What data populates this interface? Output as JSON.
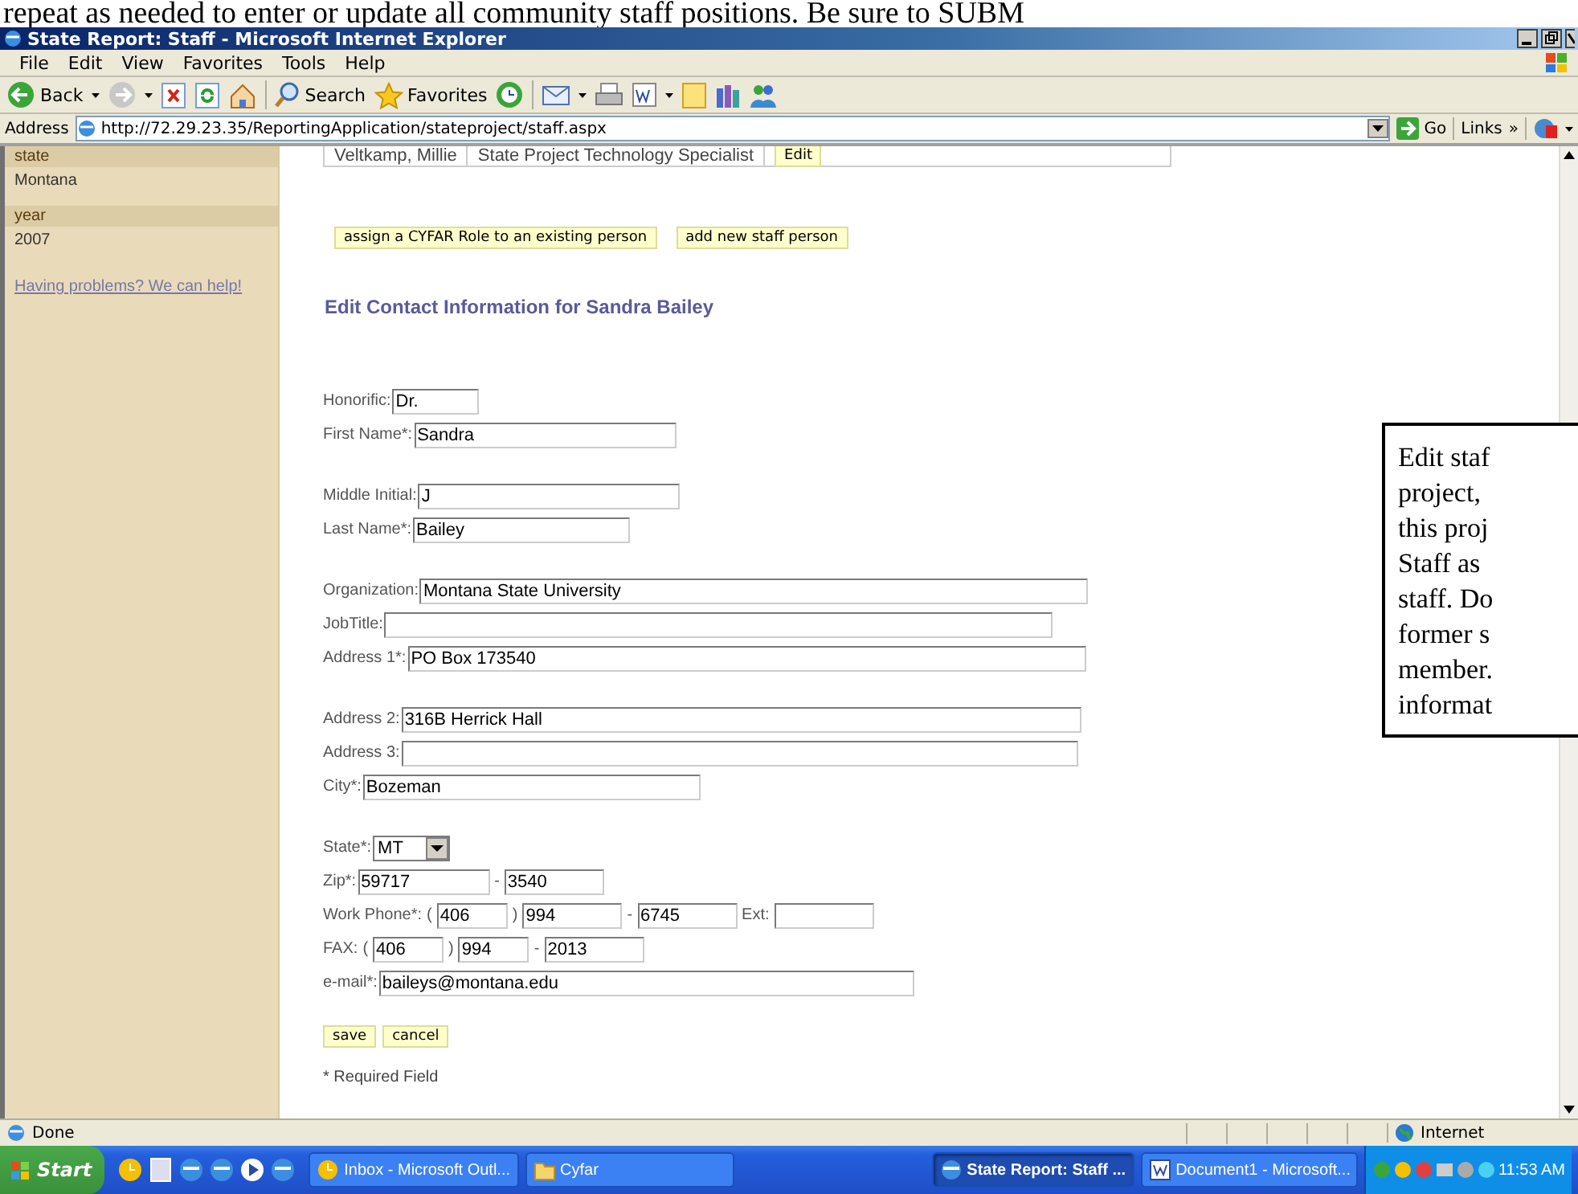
{
  "caption_line": "repeat as needed to enter or update all community staff positions. Be sure to SUBM",
  "window": {
    "title": "State Report: Staff - Microsoft Internet Explorer"
  },
  "menu": [
    "File",
    "Edit",
    "View",
    "Favorites",
    "Tools",
    "Help"
  ],
  "toolbar": {
    "back": "Back",
    "search": "Search",
    "favorites": "Favorites"
  },
  "address": {
    "label": "Address",
    "url": "http://72.29.23.35/ReportingApplication/stateproject/staff.aspx",
    "go": "Go",
    "links": "Links",
    "chevron": "»"
  },
  "sidebar": {
    "sections": [
      {
        "heading": "state",
        "value": "Montana"
      },
      {
        "heading": "year",
        "value": "2007"
      }
    ],
    "help_link": "Having problems? We can help!"
  },
  "staff_row": {
    "name": "Veltkamp, Millie",
    "role": "State Project Technology Specialist",
    "button": "Edit"
  },
  "actions": [
    "assign a CYFAR Role to an existing person",
    "add new staff person"
  ],
  "form": {
    "heading": "Edit Contact Information for Sandra Bailey",
    "groups": [
      [
        {
          "label": "Honorific:",
          "parts": [
            {
              "kind": "input",
              "value": "Dr."
            }
          ]
        },
        {
          "label": "First Name*:",
          "parts": [
            {
              "kind": "input",
              "value": "Sandra"
            }
          ]
        }
      ],
      [
        {
          "label": "Middle Initial:",
          "parts": [
            {
              "kind": "input",
              "value": "J"
            }
          ]
        },
        {
          "label": "Last Name*:",
          "parts": [
            {
              "kind": "input",
              "value": "Bailey"
            }
          ]
        }
      ],
      [
        {
          "label": "Organization:",
          "parts": [
            {
              "kind": "input",
              "value": "Montana State University"
            }
          ]
        },
        {
          "label": "JobTitle:",
          "parts": [
            {
              "kind": "input"
            }
          ]
        },
        {
          "label": "Address 1*:",
          "parts": [
            {
              "kind": "input",
              "value": "PO Box 173540"
            }
          ]
        }
      ],
      [
        {
          "label": "Address 2:",
          "parts": [
            {
              "kind": "input",
              "value": "316B Herrick Hall"
            }
          ]
        },
        {
          "label": "Address 3:",
          "parts": [
            {
              "kind": "input"
            }
          ]
        },
        {
          "label": "City*:",
          "parts": [
            {
              "kind": "input",
              "value": "Bozeman"
            }
          ]
        }
      ],
      [
        {
          "label": "State*:",
          "parts": [
            {
              "kind": "select",
              "value": "MT"
            }
          ]
        },
        {
          "label": "Zip*:",
          "parts": [
            {
              "kind": "input",
              "value": "59717"
            },
            {
              "kind": "sep",
              "text": "-"
            },
            {
              "kind": "input",
              "value": "3540"
            }
          ]
        },
        {
          "label": "Work Phone*:",
          "parts": [
            {
              "kind": "sep",
              "text": "("
            },
            {
              "kind": "input",
              "value": "406"
            },
            {
              "kind": "sep",
              "text": ")"
            },
            {
              "kind": "input",
              "value": "994"
            },
            {
              "kind": "sep",
              "text": "-"
            },
            {
              "kind": "input",
              "value": "6745"
            },
            {
              "kind": "sep",
              "text": "Ext:"
            },
            {
              "kind": "input"
            }
          ]
        },
        {
          "label": "FAX:",
          "parts": [
            {
              "kind": "sep",
              "text": "("
            },
            {
              "kind": "input",
              "value": "406"
            },
            {
              "kind": "sep",
              "text": ")"
            },
            {
              "kind": "input",
              "value": "994"
            },
            {
              "kind": "sep",
              "text": "-"
            },
            {
              "kind": "input",
              "value": "2013"
            }
          ]
        },
        {
          "label": "e-mail*:",
          "parts": [
            {
              "kind": "input",
              "value": "baileys@montana.edu"
            }
          ]
        }
      ]
    ],
    "buttons": [
      "save",
      "cancel"
    ],
    "note": "* Required Field"
  },
  "callout_lines": [
    "Edit staf",
    "project,",
    "this proj",
    "Staff as",
    "staff. Do",
    "former s",
    "member.",
    "informat"
  ],
  "status": {
    "text": "Done",
    "zone": "Internet"
  },
  "taskbar": {
    "start": "Start",
    "items": [
      {
        "label": "Inbox - Microsoft Outl...",
        "kind": "mail",
        "selected": false
      },
      {
        "label": "Cyfar",
        "kind": "folder",
        "selected": false
      },
      {
        "label": "State Report: Staff ...",
        "kind": "browser",
        "selected": true
      },
      {
        "label": "Document1 - Microsoft...",
        "kind": "doc",
        "selected": false
      }
    ],
    "clock": "11:53 AM"
  }
}
